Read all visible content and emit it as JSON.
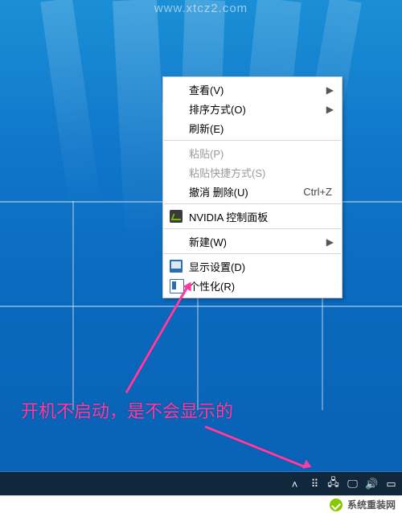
{
  "context_menu": {
    "items": [
      {
        "label": "查看(V)",
        "submenu": true
      },
      {
        "label": "排序方式(O)",
        "submenu": true
      },
      {
        "label": "刷新(E)"
      },
      {
        "sep": true
      },
      {
        "label": "粘贴(P)",
        "disabled": true
      },
      {
        "label": "粘贴快捷方式(S)",
        "disabled": true
      },
      {
        "label": "撤消 删除(U)",
        "shortcut": "Ctrl+Z"
      },
      {
        "sep": true
      },
      {
        "label": "NVIDIA 控制面板",
        "icon": "nv"
      },
      {
        "sep": true
      },
      {
        "label": "新建(W)",
        "submenu": true
      },
      {
        "sep": true
      },
      {
        "label": "显示设置(D)",
        "icon": "disp"
      },
      {
        "label": "个性化(R)",
        "icon": "pers"
      }
    ]
  },
  "annotation": {
    "text": "开机不启动，是不会显示的"
  },
  "watermark": {
    "site": "系统重装网",
    "url": "www.xtcz2.com"
  },
  "tray": {
    "icons": [
      "chevron-up-icon",
      "person-icon",
      "globe-icon",
      "monitor-icon",
      "volume-icon",
      "action-center-icon"
    ]
  }
}
